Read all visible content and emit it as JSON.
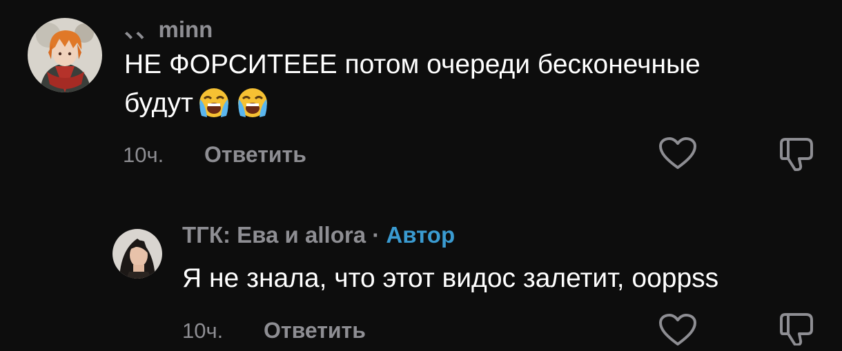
{
  "comments": [
    {
      "username": "、、minn",
      "text_line1": "НЕ ФОРСИТЕЕЕ потом очереди бесконечные",
      "text_line2": "будут",
      "emojis": [
        "loudly-crying-face",
        "loudly-crying-face"
      ],
      "time": "10ч.",
      "reply_label": "Ответить"
    },
    {
      "username": "ТГК: Ева и allora",
      "separator": "·",
      "badge": "Автор",
      "text": "Я не знала, что этот видос залетит, ooppss",
      "time": "10ч.",
      "reply_label": "Ответить"
    }
  ],
  "icons": {
    "like": "heart-icon",
    "dislike": "thumbs-down-icon"
  },
  "colors": {
    "background": "#0d0d0d",
    "text": "#ffffff",
    "secondary": "#8e8e93",
    "author_badge": "#3a9bd1"
  }
}
